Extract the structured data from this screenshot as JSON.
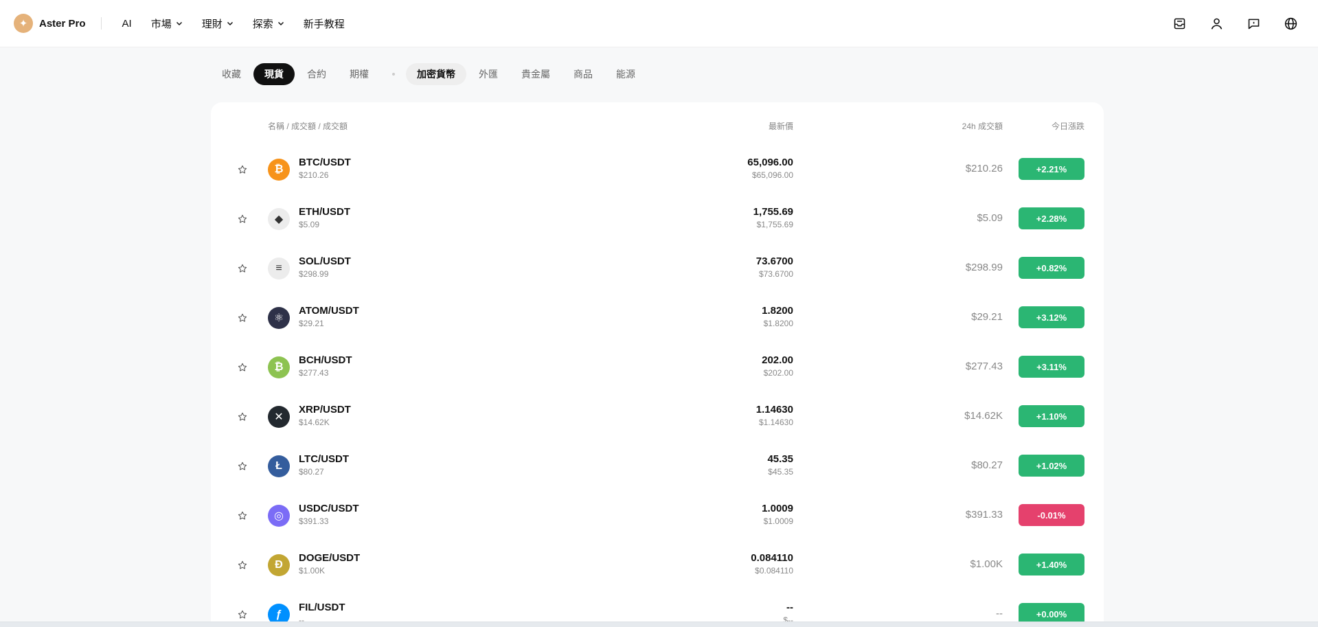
{
  "brand": {
    "name": "Aster Pro",
    "logo_glyph": "✦",
    "logo_color": "#e5b27a"
  },
  "nav": [
    {
      "label": "AI",
      "dropdown": false
    },
    {
      "label": "市場",
      "dropdown": true
    },
    {
      "label": "理財",
      "dropdown": true
    },
    {
      "label": "探索",
      "dropdown": true
    },
    {
      "label": "新手教程",
      "dropdown": false
    }
  ],
  "header_icons": [
    "inbox-icon",
    "user-icon",
    "chat-icon",
    "globe-icon"
  ],
  "tabs_left": [
    {
      "label": "收藏",
      "state": "normal"
    },
    {
      "label": "現貨",
      "state": "active"
    },
    {
      "label": "合約",
      "state": "normal"
    },
    {
      "label": "期權",
      "state": "normal"
    }
  ],
  "tabs_right": [
    {
      "label": "加密貨幣",
      "state": "selected"
    },
    {
      "label": "外匯",
      "state": "normal"
    },
    {
      "label": "貴金屬",
      "state": "normal"
    },
    {
      "label": "商品",
      "state": "normal"
    },
    {
      "label": "能源",
      "state": "normal"
    }
  ],
  "table": {
    "headers": {
      "name": "名稱 / 成交額 / 成交額",
      "price": "最新價",
      "volume": "24h 成交額",
      "change": "今日漲跌"
    },
    "rows": [
      {
        "pair": "BTC/USDT",
        "sub": "$210.26",
        "price": "65,096.00",
        "price_sub": "$65,096.00",
        "volume": "$210.26",
        "change": "+2.21%",
        "direction": "up",
        "coin_color": "#f7931a",
        "coin_glyph": "₿",
        "coin_icon": "bitcoin-icon"
      },
      {
        "pair": "ETH/USDT",
        "sub": "$5.09",
        "price": "1,755.69",
        "price_sub": "$1,755.69",
        "volume": "$5.09",
        "change": "+2.28%",
        "direction": "up",
        "coin_color": "#ececec",
        "coin_glyph": "◆",
        "coin_icon": "ethereum-icon"
      },
      {
        "pair": "SOL/USDT",
        "sub": "$298.99",
        "price": "73.6700",
        "price_sub": "$73.6700",
        "volume": "$298.99",
        "change": "+0.82%",
        "direction": "up",
        "coin_color": "#ececec",
        "coin_glyph": "≡",
        "coin_icon": "solana-icon"
      },
      {
        "pair": "ATOM/USDT",
        "sub": "$29.21",
        "price": "1.8200",
        "price_sub": "$1.8200",
        "volume": "$29.21",
        "change": "+3.12%",
        "direction": "up",
        "coin_color": "#2e3148",
        "coin_glyph": "⚛",
        "coin_icon": "cosmos-icon"
      },
      {
        "pair": "BCH/USDT",
        "sub": "$277.43",
        "price": "202.00",
        "price_sub": "$202.00",
        "volume": "$277.43",
        "change": "+3.11%",
        "direction": "up",
        "coin_color": "#8dc351",
        "coin_glyph": "₿",
        "coin_icon": "bitcoin-cash-icon"
      },
      {
        "pair": "XRP/USDT",
        "sub": "$14.62K",
        "price": "1.14630",
        "price_sub": "$1.14630",
        "volume": "$14.62K",
        "change": "+1.10%",
        "direction": "up",
        "coin_color": "#23292f",
        "coin_glyph": "✕",
        "coin_icon": "xrp-icon"
      },
      {
        "pair": "LTC/USDT",
        "sub": "$80.27",
        "price": "45.35",
        "price_sub": "$45.35",
        "volume": "$80.27",
        "change": "+1.02%",
        "direction": "up",
        "coin_color": "#345d9d",
        "coin_glyph": "Ł",
        "coin_icon": "litecoin-icon"
      },
      {
        "pair": "USDC/USDT",
        "sub": "$391.33",
        "price": "1.0009",
        "price_sub": "$1.0009",
        "volume": "$391.33",
        "change": "-0.01%",
        "direction": "down",
        "coin_color": "#7b6cf6",
        "coin_glyph": "◎",
        "coin_icon": "usdc-icon"
      },
      {
        "pair": "DOGE/USDT",
        "sub": "$1.00K",
        "price": "0.084110",
        "price_sub": "$0.084110",
        "volume": "$1.00K",
        "change": "+1.40%",
        "direction": "up",
        "coin_color": "#c2a633",
        "coin_glyph": "Ð",
        "coin_icon": "dogecoin-icon"
      },
      {
        "pair": "FIL/USDT",
        "sub": "--",
        "price": "--",
        "price_sub": "$--",
        "volume": "--",
        "change": "+0.00%",
        "direction": "up",
        "coin_color": "#0090ff",
        "coin_glyph": "ƒ",
        "coin_icon": "filecoin-icon"
      }
    ]
  },
  "colors": {
    "up": "#2bb673",
    "down": "#e5416d"
  }
}
